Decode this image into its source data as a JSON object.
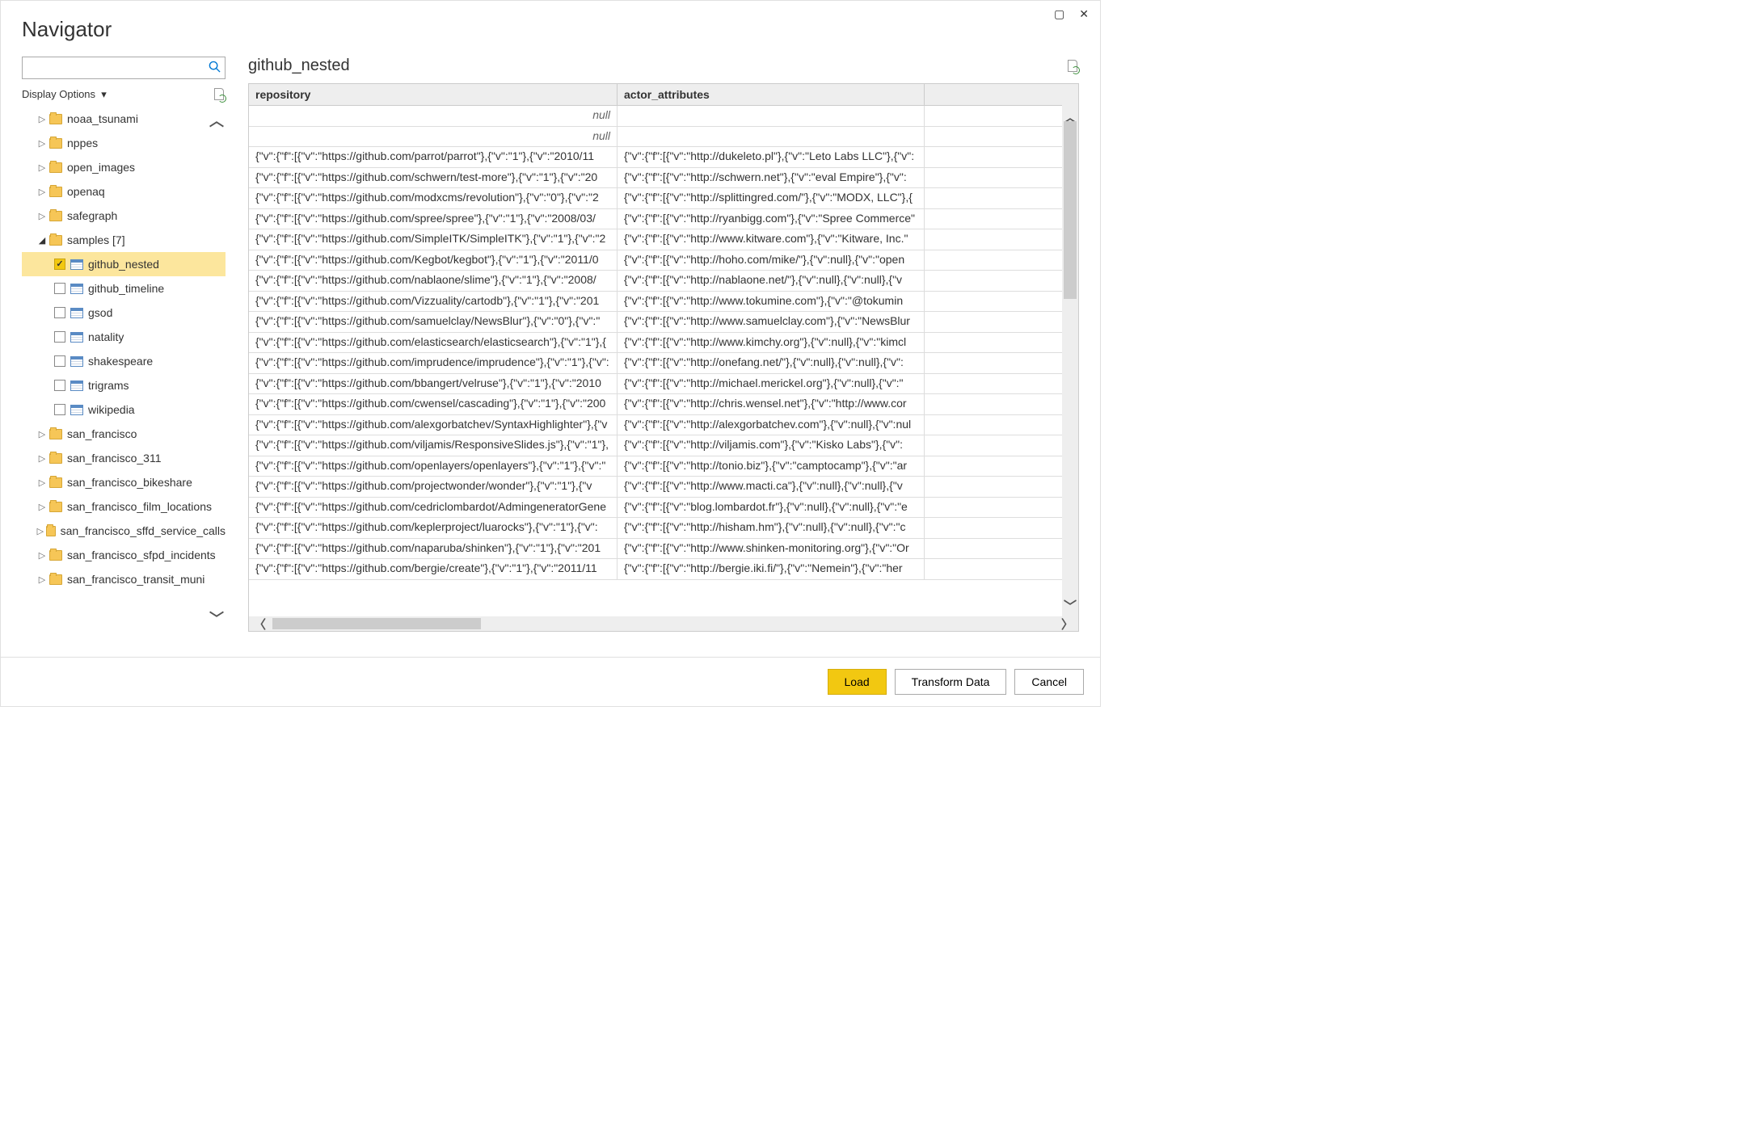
{
  "window": {
    "title": "Navigator"
  },
  "display_options_label": "Display Options",
  "tree": {
    "folders_before": [
      "noaa_tsunami",
      "nppes",
      "open_images",
      "openaq",
      "safegraph"
    ],
    "samples_label": "samples [7]",
    "samples_children": [
      {
        "label": "github_nested",
        "checked": true
      },
      {
        "label": "github_timeline",
        "checked": false
      },
      {
        "label": "gsod",
        "checked": false
      },
      {
        "label": "natality",
        "checked": false
      },
      {
        "label": "shakespeare",
        "checked": false
      },
      {
        "label": "trigrams",
        "checked": false
      },
      {
        "label": "wikipedia",
        "checked": false
      }
    ],
    "folders_after": [
      "san_francisco",
      "san_francisco_311",
      "san_francisco_bikeshare",
      "san_francisco_film_locations",
      "san_francisco_sffd_service_calls",
      "san_francisco_sfpd_incidents",
      "san_francisco_transit_muni"
    ]
  },
  "preview": {
    "title": "github_nested",
    "columns": [
      "repository",
      "actor_attributes"
    ],
    "nullrows": [
      "null",
      "null"
    ],
    "rows": [
      [
        "{\"v\":{\"f\":[{\"v\":\"https://github.com/parrot/parrot\"},{\"v\":\"1\"},{\"v\":\"2010/11",
        "{\"v\":{\"f\":[{\"v\":\"http://dukeleto.pl\"},{\"v\":\"Leto Labs LLC\"},{\"v\":"
      ],
      [
        "{\"v\":{\"f\":[{\"v\":\"https://github.com/schwern/test-more\"},{\"v\":\"1\"},{\"v\":\"20",
        "{\"v\":{\"f\":[{\"v\":\"http://schwern.net\"},{\"v\":\"eval Empire\"},{\"v\":"
      ],
      [
        "{\"v\":{\"f\":[{\"v\":\"https://github.com/modxcms/revolution\"},{\"v\":\"0\"},{\"v\":\"2",
        "{\"v\":{\"f\":[{\"v\":\"http://splittingred.com/\"},{\"v\":\"MODX, LLC\"},{"
      ],
      [
        "{\"v\":{\"f\":[{\"v\":\"https://github.com/spree/spree\"},{\"v\":\"1\"},{\"v\":\"2008/03/",
        "{\"v\":{\"f\":[{\"v\":\"http://ryanbigg.com\"},{\"v\":\"Spree Commerce\""
      ],
      [
        "{\"v\":{\"f\":[{\"v\":\"https://github.com/SimpleITK/SimpleITK\"},{\"v\":\"1\"},{\"v\":\"2",
        "{\"v\":{\"f\":[{\"v\":\"http://www.kitware.com\"},{\"v\":\"Kitware, Inc.\""
      ],
      [
        "{\"v\":{\"f\":[{\"v\":\"https://github.com/Kegbot/kegbot\"},{\"v\":\"1\"},{\"v\":\"2011/0",
        "{\"v\":{\"f\":[{\"v\":\"http://hoho.com/mike/\"},{\"v\":null},{\"v\":\"open"
      ],
      [
        "{\"v\":{\"f\":[{\"v\":\"https://github.com/nablaone/slime\"},{\"v\":\"1\"},{\"v\":\"2008/",
        "{\"v\":{\"f\":[{\"v\":\"http://nablaone.net/\"},{\"v\":null},{\"v\":null},{\"v"
      ],
      [
        "{\"v\":{\"f\":[{\"v\":\"https://github.com/Vizzuality/cartodb\"},{\"v\":\"1\"},{\"v\":\"201",
        "{\"v\":{\"f\":[{\"v\":\"http://www.tokumine.com\"},{\"v\":\"@tokumin"
      ],
      [
        "{\"v\":{\"f\":[{\"v\":\"https://github.com/samuelclay/NewsBlur\"},{\"v\":\"0\"},{\"v\":\"",
        "{\"v\":{\"f\":[{\"v\":\"http://www.samuelclay.com\"},{\"v\":\"NewsBlur"
      ],
      [
        "{\"v\":{\"f\":[{\"v\":\"https://github.com/elasticsearch/elasticsearch\"},{\"v\":\"1\"},{",
        "{\"v\":{\"f\":[{\"v\":\"http://www.kimchy.org\"},{\"v\":null},{\"v\":\"kimcl"
      ],
      [
        "{\"v\":{\"f\":[{\"v\":\"https://github.com/imprudence/imprudence\"},{\"v\":\"1\"},{\"v\":",
        "{\"v\":{\"f\":[{\"v\":\"http://onefang.net/\"},{\"v\":null},{\"v\":null},{\"v\":"
      ],
      [
        "{\"v\":{\"f\":[{\"v\":\"https://github.com/bbangert/velruse\"},{\"v\":\"1\"},{\"v\":\"2010",
        "{\"v\":{\"f\":[{\"v\":\"http://michael.merickel.org\"},{\"v\":null},{\"v\":\""
      ],
      [
        "{\"v\":{\"f\":[{\"v\":\"https://github.com/cwensel/cascading\"},{\"v\":\"1\"},{\"v\":\"200",
        "{\"v\":{\"f\":[{\"v\":\"http://chris.wensel.net\"},{\"v\":\"http://www.cor"
      ],
      [
        "{\"v\":{\"f\":[{\"v\":\"https://github.com/alexgorbatchev/SyntaxHighlighter\"},{\"v",
        "{\"v\":{\"f\":[{\"v\":\"http://alexgorbatchev.com\"},{\"v\":null},{\"v\":nul"
      ],
      [
        "{\"v\":{\"f\":[{\"v\":\"https://github.com/viljamis/ResponsiveSlides.js\"},{\"v\":\"1\"},",
        "{\"v\":{\"f\":[{\"v\":\"http://viljamis.com\"},{\"v\":\"Kisko Labs\"},{\"v\":"
      ],
      [
        "{\"v\":{\"f\":[{\"v\":\"https://github.com/openlayers/openlayers\"},{\"v\":\"1\"},{\"v\":\"",
        "{\"v\":{\"f\":[{\"v\":\"http://tonio.biz\"},{\"v\":\"camptocamp\"},{\"v\":\"ar"
      ],
      [
        "{\"v\":{\"f\":[{\"v\":\"https://github.com/projectwonder/wonder\"},{\"v\":\"1\"},{\"v",
        "{\"v\":{\"f\":[{\"v\":\"http://www.macti.ca\"},{\"v\":null},{\"v\":null},{\"v"
      ],
      [
        "{\"v\":{\"f\":[{\"v\":\"https://github.com/cedriclombardot/AdmingeneratorGene",
        "{\"v\":{\"f\":[{\"v\":\"blog.lombardot.fr\"},{\"v\":null},{\"v\":null},{\"v\":\"e"
      ],
      [
        "{\"v\":{\"f\":[{\"v\":\"https://github.com/keplerproject/luarocks\"},{\"v\":\"1\"},{\"v\":",
        "{\"v\":{\"f\":[{\"v\":\"http://hisham.hm\"},{\"v\":null},{\"v\":null},{\"v\":\"c"
      ],
      [
        "{\"v\":{\"f\":[{\"v\":\"https://github.com/naparuba/shinken\"},{\"v\":\"1\"},{\"v\":\"201",
        "{\"v\":{\"f\":[{\"v\":\"http://www.shinken-monitoring.org\"},{\"v\":\"Or"
      ],
      [
        "{\"v\":{\"f\":[{\"v\":\"https://github.com/bergie/create\"},{\"v\":\"1\"},{\"v\":\"2011/11",
        "{\"v\":{\"f\":[{\"v\":\"http://bergie.iki.fi/\"},{\"v\":\"Nemein\"},{\"v\":\"her"
      ]
    ]
  },
  "buttons": {
    "load": "Load",
    "transform": "Transform Data",
    "cancel": "Cancel"
  }
}
